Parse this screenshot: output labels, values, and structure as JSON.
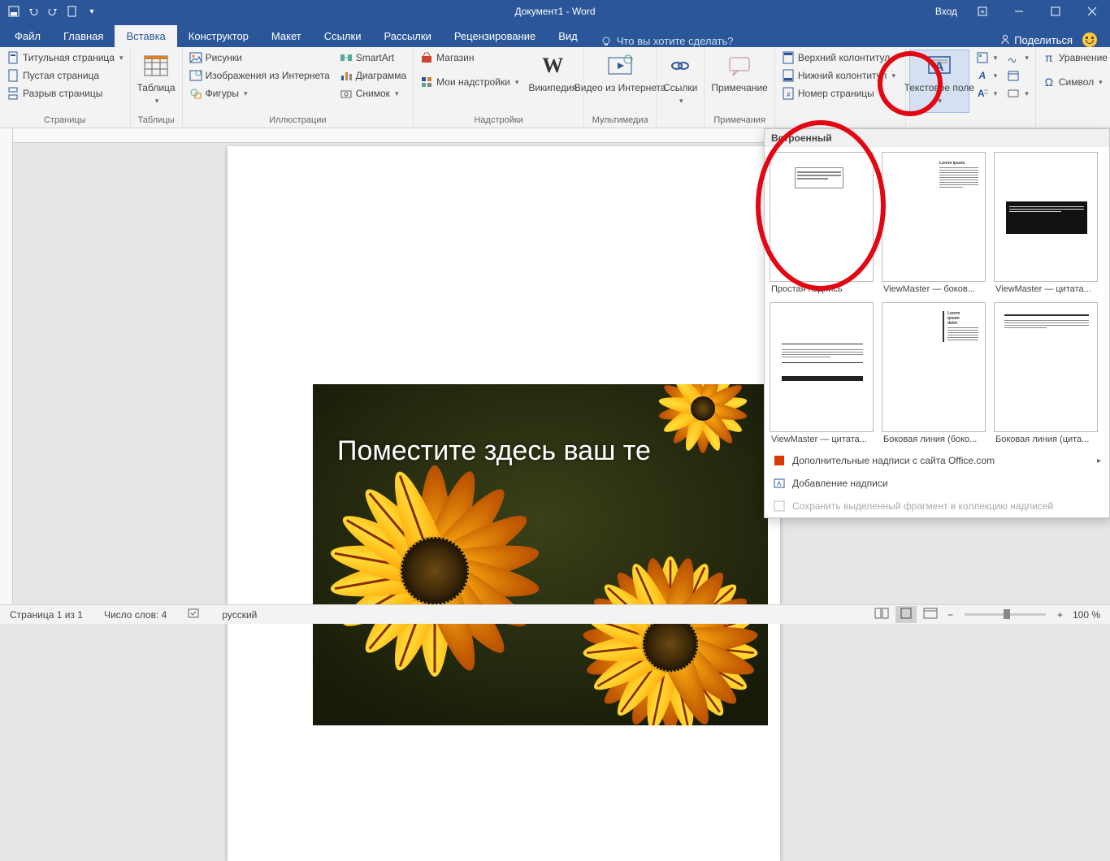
{
  "titlebar": {
    "title": "Документ1 - Word",
    "signin": "Вход"
  },
  "tabs": {
    "file": "Файл",
    "home": "Главная",
    "insert": "Вставка",
    "design": "Конструктор",
    "layout": "Макет",
    "references": "Ссылки",
    "mailings": "Рассылки",
    "review": "Рецензирование",
    "view": "Вид",
    "tellme": "Что вы хотите сделать?",
    "share": "Поделиться"
  },
  "ribbon": {
    "pages": {
      "cover": "Титульная страница",
      "blank": "Пустая страница",
      "break": "Разрыв страницы",
      "group": "Страницы"
    },
    "tables": {
      "table": "Таблица",
      "group": "Таблицы"
    },
    "illus": {
      "pictures": "Рисунки",
      "online": "Изображения из Интернета",
      "shapes": "Фигуры",
      "smartart": "SmartArt",
      "chart": "Диаграмма",
      "screenshot": "Снимок",
      "group": "Иллюстрации"
    },
    "addins": {
      "store": "Магазин",
      "my": "Мои надстройки",
      "wiki": "Википедия",
      "group": "Надстройки"
    },
    "media": {
      "video": "Видео из Интернета",
      "group": "Мультимедиа"
    },
    "links": {
      "links": "Ссылки",
      "group": ""
    },
    "comments": {
      "comment": "Примечание",
      "group": "Примечания"
    },
    "headerfooter": {
      "header": "Верхний колонтитул",
      "footer": "Нижний колонтитул",
      "page": "Номер страницы",
      "group": ""
    },
    "text": {
      "textbox": "Текстовое поле",
      "group": ""
    },
    "symbols": {
      "equation": "Уравнение",
      "symbol": "Символ",
      "group": ""
    }
  },
  "document": {
    "overlay_text": "Поместите здесь ваш те"
  },
  "gallery": {
    "header": "Встроенный",
    "items": [
      "Простая надпись",
      "ViewMaster — боков...",
      "ViewMaster — цитата...",
      "ViewMaster — цитата...",
      "Боковая линия (боко...",
      "Боковая линия (цита..."
    ],
    "footer": {
      "more": "Дополнительные надписи с сайта Office.com",
      "draw": "Добавление надписи",
      "save": "Сохранить выделенный фрагмент в коллекцию надписей"
    }
  },
  "statusbar": {
    "page": "Страница 1 из 1",
    "words": "Число слов: 4",
    "lang": "русский",
    "zoom": "100 %"
  }
}
